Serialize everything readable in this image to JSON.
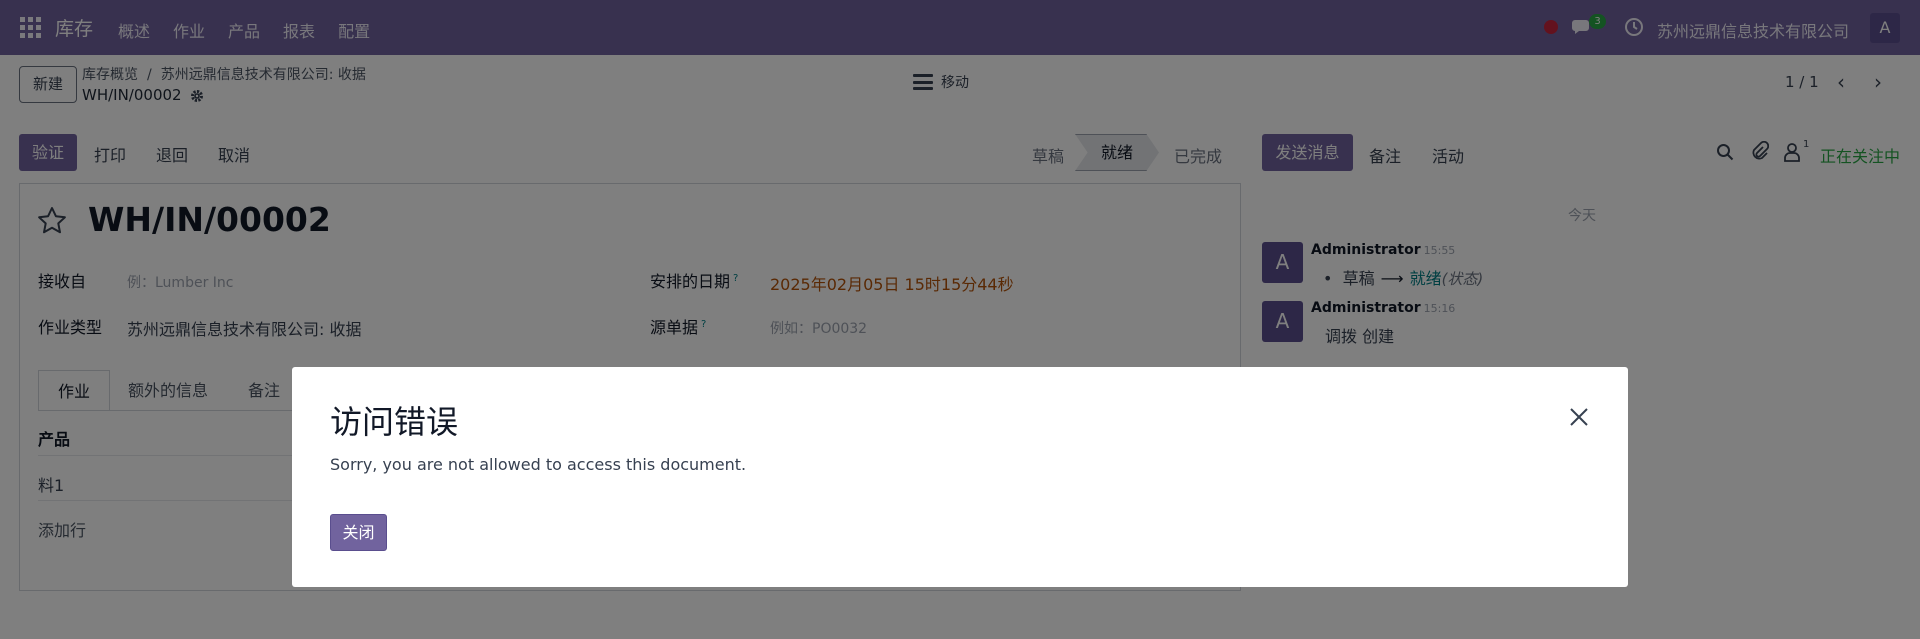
{
  "navbar": {
    "app_name": "库存",
    "menu": [
      "概述",
      "作业",
      "产品",
      "报表",
      "配置"
    ],
    "chat_count": "3",
    "company": "苏州远鼎信息技术有限公司",
    "avatar_letter": "A",
    "icons": [
      "apps-grid-icon",
      "red-status-dot",
      "chat-icon",
      "clock-icon"
    ]
  },
  "control_panel": {
    "new_label": "新建",
    "breadcrumb": [
      "库存概览",
      "苏州远鼎信息技术有限公司: 收据"
    ],
    "record": "WH/IN/00002",
    "move_label": "移动",
    "pager": "1 / 1"
  },
  "actions": {
    "validate": "验证",
    "print": "打印",
    "return": "退回",
    "cancel": "取消"
  },
  "status": {
    "steps": [
      "草稿",
      "就绪",
      "已完成"
    ],
    "active": "就绪"
  },
  "form": {
    "title": "WH/IN/00002",
    "receiver_label": "接收自",
    "receiver_placeholder": "例：Lumber Inc",
    "op_type_label": "作业类型",
    "op_type_value": "苏州远鼎信息技术有限公司: 收据",
    "scheduled_label": "安排的日期",
    "scheduled_value": "2025年02月05日 15时15分44秒",
    "source_label": "源单据",
    "source_placeholder": "例如：PO0032",
    "help_mark": "?",
    "tabs": [
      "作业",
      "额外的信息",
      "备注"
    ],
    "table_header": "产品",
    "rows": [
      "料1"
    ],
    "add_line": "添加行"
  },
  "chatter": {
    "send_message": "发送消息",
    "note": "备注",
    "activity": "活动",
    "follower_count": "1",
    "following": "正在关注中",
    "today": "今天",
    "messages": [
      {
        "avatar": "A",
        "author": "Administrator",
        "time": "15:55",
        "old": "草稿",
        "arrow": "⟶",
        "new": "就绪",
        "field": "(状态)"
      },
      {
        "avatar": "A",
        "author": "Administrator",
        "time": "15:16",
        "text": "调拨 创建"
      }
    ]
  },
  "dialog": {
    "title": "访问错误",
    "message": "Sorry, you are not allowed to access this document.",
    "close_button": "关闭"
  },
  "colors": {
    "brand": "#71639e",
    "success": "#28a745",
    "danger": "#c7253c",
    "date": "#b45309"
  }
}
